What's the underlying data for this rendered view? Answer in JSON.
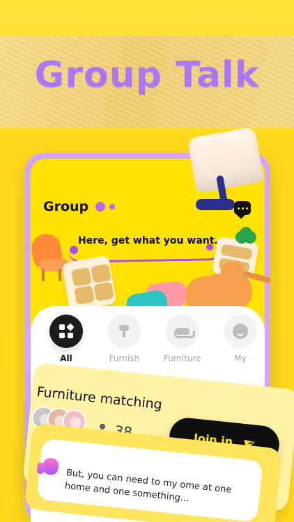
{
  "hero": {
    "title": "Group Talk"
  },
  "app": {
    "header_title": "Group",
    "tagline": "Here, get what you want."
  },
  "categories": [
    {
      "label": "All",
      "icon": "grid-icon",
      "active": true
    },
    {
      "label": "Furnish",
      "icon": "brush-icon",
      "active": false
    },
    {
      "label": "Furniture",
      "icon": "sofa-icon",
      "active": false
    },
    {
      "label": "My",
      "icon": "user-icon",
      "active": false
    }
  ],
  "group_card": {
    "title": "Furniture matching",
    "member_count": "38",
    "join_label": "Join in",
    "message": "But, you can need to my ome at one home and one something..."
  },
  "colors": {
    "background_yellow": "#ffd91e",
    "purple": "#a978ff",
    "black": "#111111",
    "accent_yellow": "#ffe300"
  }
}
